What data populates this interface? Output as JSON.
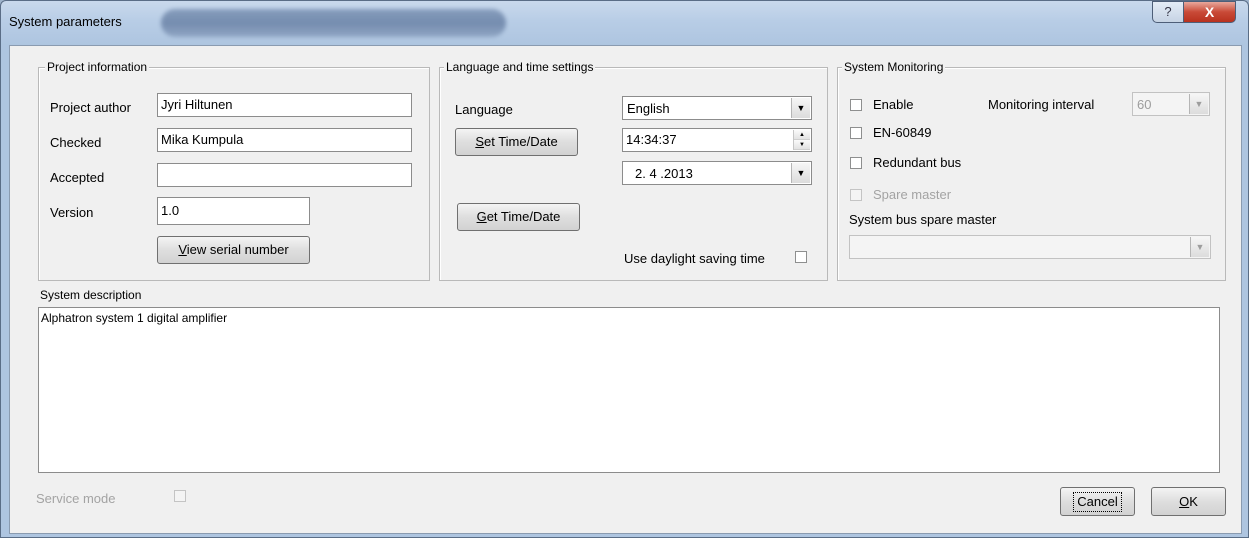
{
  "window": {
    "title": "System parameters",
    "help_glyph": "?",
    "close_glyph": "X"
  },
  "project_info": {
    "legend": "Project information",
    "author_label": "Project author",
    "author_value": "Jyri Hiltunen",
    "checked_label": "Checked",
    "checked_value": "Mika Kumpula",
    "accepted_label": "Accepted",
    "accepted_value": "",
    "version_label": "Version",
    "version_value": "1.0",
    "view_serial_button_u": "V",
    "view_serial_button_rest": "iew serial number"
  },
  "lang_time": {
    "legend": "Language and time settings",
    "language_label": "Language",
    "language_value": "English",
    "set_time_button_u": "S",
    "set_time_button_rest": "et Time/Date",
    "time_value": "14:34:37",
    "date_value": "2. 4 .2013",
    "get_time_button_u": "G",
    "get_time_button_rest": "et Time/Date",
    "daylight_label": "Use daylight saving time",
    "daylight_checked": false
  },
  "monitoring": {
    "legend": "System Monitoring",
    "enable_label": "Enable",
    "interval_label": "Monitoring interval",
    "interval_value": "60",
    "en60849_label": "EN-60849",
    "redundant_label": "Redundant bus",
    "spare_master_label": "Spare master",
    "spare_bus_label": "System bus spare master",
    "spare_bus_value": ""
  },
  "description": {
    "label": "System description",
    "value": "Alphatron system 1 digital amplifier"
  },
  "footer": {
    "service_mode_label": "Service mode",
    "cancel_label": "Cancel",
    "ok_u": "O",
    "ok_rest": "K"
  },
  "icons": {
    "dropdown": "▼",
    "spin_up": "▲",
    "spin_down": "▼"
  }
}
